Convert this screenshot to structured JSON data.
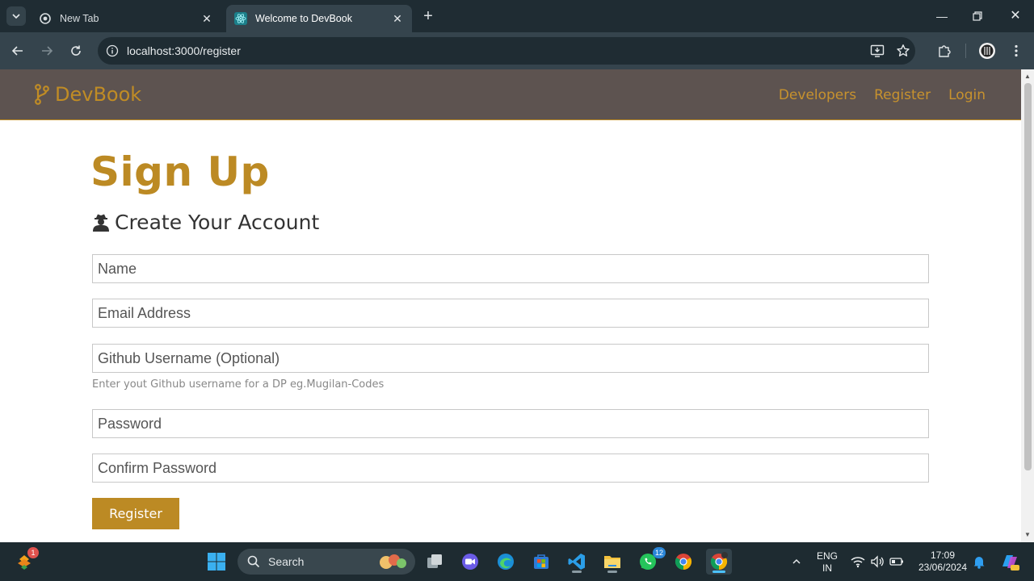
{
  "browser": {
    "tabs": [
      {
        "title": "New Tab",
        "active": false
      },
      {
        "title": "Welcome to DevBook",
        "active": true
      }
    ],
    "url": "localhost:3000/register"
  },
  "site": {
    "brand": "DevBook",
    "nav": [
      "Developers",
      "Register",
      "Login"
    ]
  },
  "form": {
    "heading": "Sign Up",
    "subheading": "Create Your Account",
    "fields": {
      "name_placeholder": "Name",
      "email_placeholder": "Email Address",
      "github_placeholder": "Github Username (Optional)",
      "github_hint": "Enter yout Github username for a DP eg.Mugilan-Codes",
      "password_placeholder": "Password",
      "confirm_placeholder": "Confirm Password"
    },
    "submit_label": "Register"
  },
  "taskbar": {
    "search_label": "Search",
    "widgets_badge": "1",
    "whatsapp_badge": "12",
    "lang_line1": "ENG",
    "lang_line2": "IN",
    "time": "17:09",
    "date": "23/06/2024"
  },
  "colors": {
    "accent": "#bc8a24",
    "navbar": "#5d5350",
    "chrome_dark": "#1f2c33",
    "chrome_toolbar": "#35444d"
  }
}
